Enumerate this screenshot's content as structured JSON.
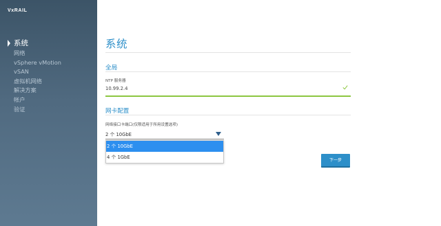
{
  "sidebar": {
    "logo": "VxRAIL",
    "items": [
      {
        "label": "系统",
        "active": true
      },
      {
        "label": "网络",
        "active": false
      },
      {
        "label": "vSphere vMotion",
        "active": false
      },
      {
        "label": "vSAN",
        "active": false
      },
      {
        "label": "虚拟机网络",
        "active": false
      },
      {
        "label": "解决方案",
        "active": false
      },
      {
        "label": "帐户",
        "active": false
      },
      {
        "label": "验证",
        "active": false
      }
    ]
  },
  "main": {
    "title": "系统",
    "global": {
      "heading": "全局",
      "ntp_label": "NTP 服务器",
      "ntp_value": "10.99.2.4",
      "check_icon": "checkmark-icon"
    },
    "nic": {
      "heading": "网卡配置",
      "select_label": "网络接口卡端口(仅限适用于所用设置选项)",
      "selected_value": "2 个 10GbE",
      "options": [
        "2 个 10GbE",
        "4 个 1GbE"
      ]
    },
    "next_button": "下一步"
  },
  "colors": {
    "accent": "#2d8fc9",
    "valid": "#8cc63f",
    "selection": "#2d8fef",
    "sidebar_top": "#3c5467"
  }
}
